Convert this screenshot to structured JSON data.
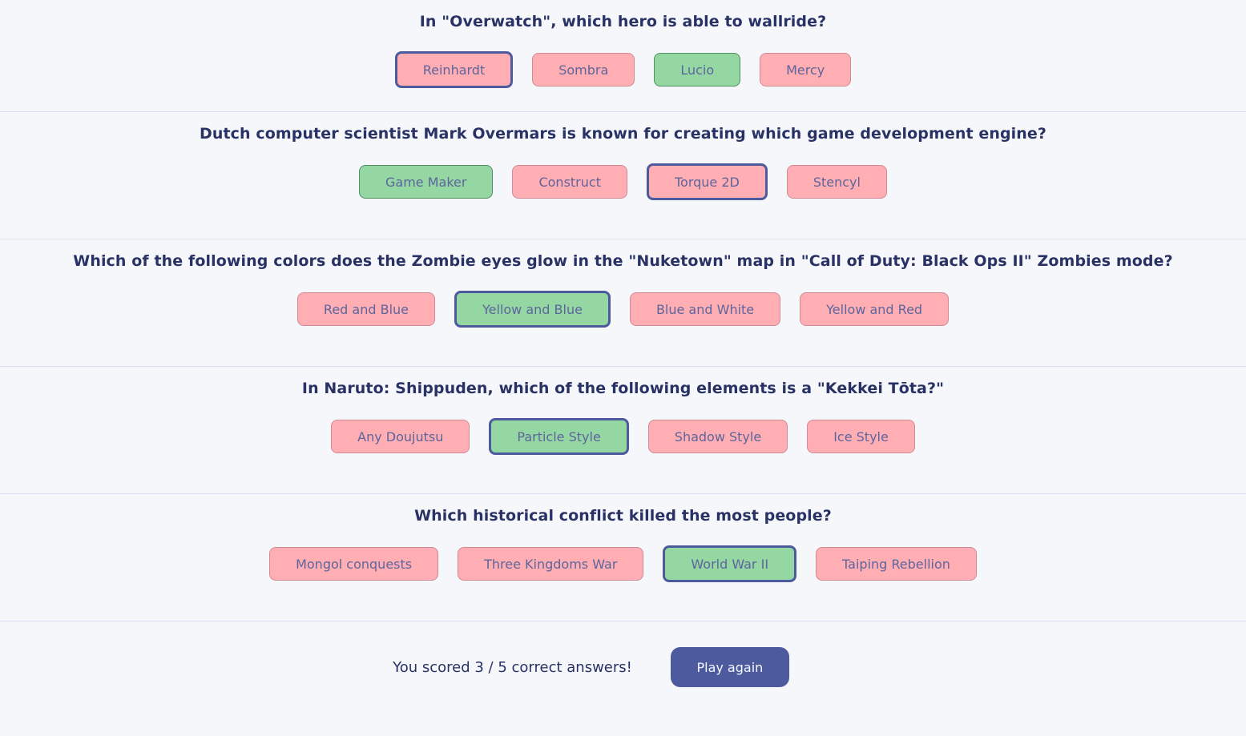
{
  "questions": [
    {
      "text": "In \"Overwatch\", which hero is able to wallride?",
      "answers": [
        "Reinhardt",
        "Sombra",
        "Lucio",
        "Mercy"
      ]
    },
    {
      "text": "Dutch computer scientist Mark Overmars is known for creating which game development engine?",
      "answers": [
        "Game Maker",
        "Construct",
        "Torque 2D",
        "Stencyl"
      ]
    },
    {
      "text": "Which of the following colors does the Zombie eyes glow in the \"Nuketown\" map in \"Call of Duty: Black Ops II\" Zombies mode?",
      "answers": [
        "Red and Blue",
        "Yellow and Blue",
        "Blue and White",
        "Yellow and Red"
      ]
    },
    {
      "text": "In Naruto: Shippuden, which of the following elements is a \"Kekkei Tōta?\"",
      "answers": [
        "Any Doujutsu",
        "Particle Style",
        "Shadow Style",
        "Ice Style"
      ]
    },
    {
      "text": "Which historical conflict killed the most people?",
      "answers": [
        "Mongol conquests",
        "Three Kingdoms War",
        "World War II",
        "Taiping Rebellion"
      ]
    }
  ],
  "footer": {
    "score_text": "You scored 3 / 5 correct answers!",
    "play_again_label": "Play again"
  },
  "colors": {
    "correct": "#94d7a2",
    "incorrect": "#ffaeb4",
    "selected_border": "#4d5b9e",
    "text": "#293264",
    "background": "#f5f7fb"
  }
}
